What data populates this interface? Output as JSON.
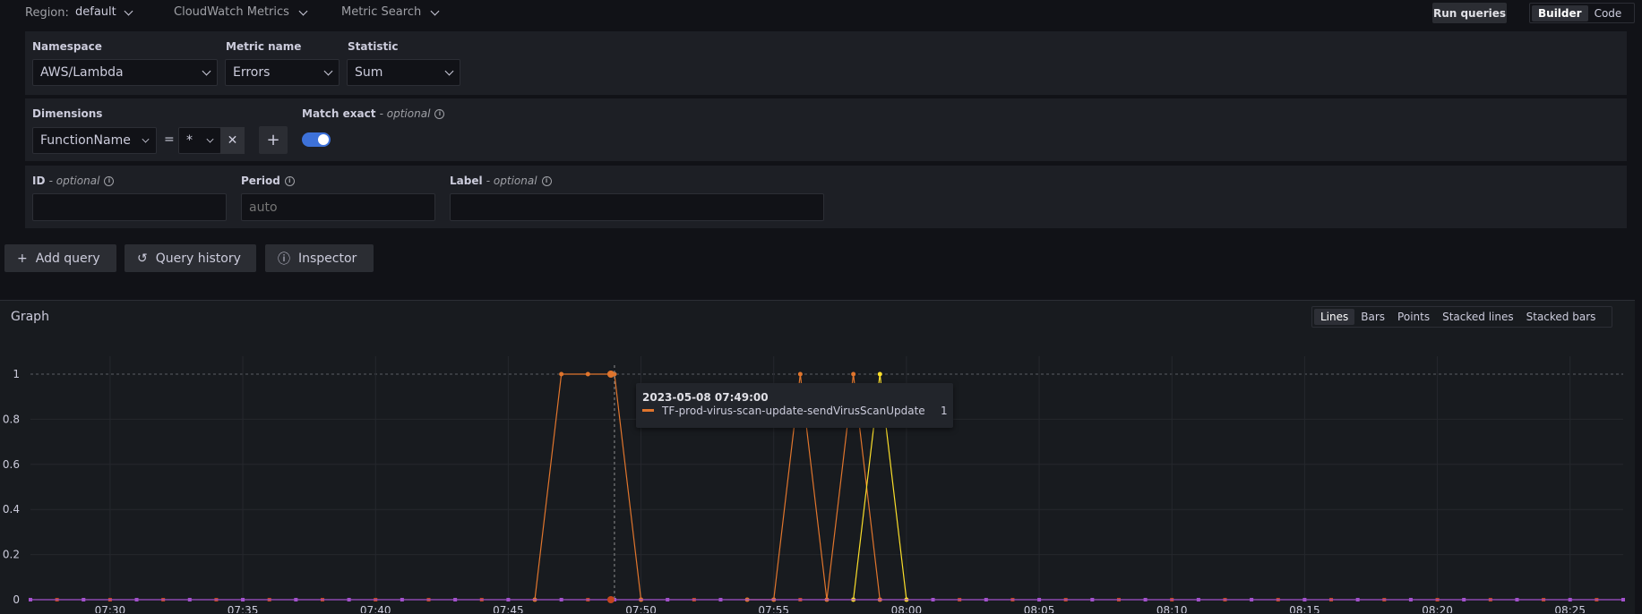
{
  "topbar": {
    "region_label": "Region:",
    "region_value": "default",
    "source": "CloudWatch Metrics",
    "mode": "Metric Search",
    "run_label": "Run queries",
    "editor_modes": [
      "Builder",
      "Code"
    ],
    "editor_active": "Builder"
  },
  "query": {
    "namespace_label": "Namespace",
    "namespace_value": "AWS/Lambda",
    "metric_label": "Metric name",
    "metric_value": "Errors",
    "statistic_label": "Statistic",
    "statistic_value": "Sum",
    "dimensions_label": "Dimensions",
    "dimension_key": "FunctionName",
    "dimension_op": "=",
    "dimension_value": "*",
    "match_exact_label": "Match exact",
    "optional_text": "- optional",
    "match_exact_on": true,
    "id_label": "ID",
    "id_value": "",
    "period_label": "Period",
    "period_placeholder": "auto",
    "label_label": "Label",
    "label_value": ""
  },
  "actions": {
    "add_query": "Add query",
    "query_history": "Query history",
    "inspector": "Inspector"
  },
  "graph": {
    "title": "Graph",
    "modes": [
      "Lines",
      "Bars",
      "Points",
      "Stacked lines",
      "Stacked bars"
    ],
    "active_mode": "Lines",
    "tooltip": {
      "time": "2023-05-08 07:49:00",
      "series": "TF-prod-virus-scan-update-sendVirusScanUpdate",
      "value": "1",
      "color": "#e0752d"
    }
  },
  "chart_data": {
    "type": "line",
    "ylim": [
      0,
      1
    ],
    "yticks": [
      "0",
      "0.2",
      "0.4",
      "0.6",
      "0.8",
      "1"
    ],
    "xticks": [
      "07:30",
      "07:35",
      "07:40",
      "07:45",
      "07:50",
      "07:55",
      "08:00",
      "08:05",
      "08:10",
      "08:15",
      "08:20",
      "08:25"
    ],
    "x_start_minute": 27,
    "x_end_minute": 87,
    "series": [
      {
        "name": "TF-prod-virus-scan-update-sendVirusScanUpdate",
        "color": "#e0752d",
        "x": [
          46,
          47,
          48,
          49,
          50
        ],
        "y": [
          0,
          1,
          1,
          1,
          0
        ]
      },
      {
        "color": "#e0752d",
        "x": [
          54,
          55,
          56,
          57,
          58,
          59
        ],
        "y": [
          0,
          0,
          1,
          0,
          1,
          0
        ]
      },
      {
        "color": "#fade2a",
        "x": [
          58,
          59,
          60
        ],
        "y": [
          0,
          1,
          0
        ]
      },
      {
        "color": "#a352cc",
        "x": [
          27,
          87
        ],
        "y": [
          0,
          0
        ]
      }
    ]
  }
}
